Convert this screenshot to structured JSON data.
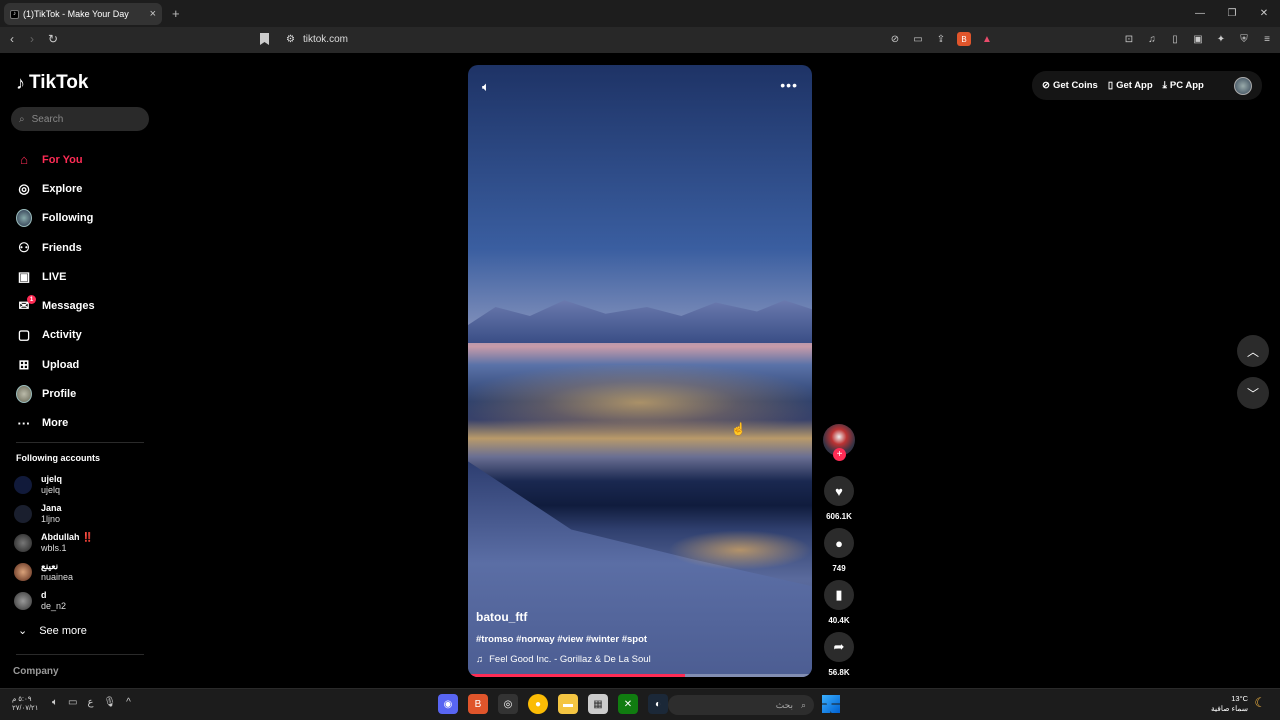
{
  "browser": {
    "tab_title": "(1)TikTok - Make Your Day",
    "url": "tiktok.com",
    "new_tab": "+",
    "close": "×"
  },
  "sidebar": {
    "logo": "TikTok",
    "search_placeholder": "Search",
    "items": [
      {
        "label": "For You",
        "icon": "home-icon"
      },
      {
        "label": "Explore",
        "icon": "compass-icon"
      },
      {
        "label": "Following",
        "icon": "avatar-icon"
      },
      {
        "label": "Friends",
        "icon": "friends-icon"
      },
      {
        "label": "LIVE",
        "icon": "live-icon"
      },
      {
        "label": "Messages",
        "icon": "messages-icon",
        "badge": "1"
      },
      {
        "label": "Activity",
        "icon": "activity-icon"
      },
      {
        "label": "Upload",
        "icon": "upload-icon"
      },
      {
        "label": "Profile",
        "icon": "profile-icon"
      },
      {
        "label": "More",
        "icon": "more-icon"
      }
    ],
    "following_title": "Following accounts",
    "accounts": [
      {
        "name": "ujelq",
        "username": "ujelq"
      },
      {
        "name": "Jana",
        "username": "1ljno"
      },
      {
        "name": "Abdullah ‼️",
        "username": "wbls.1"
      },
      {
        "name": "نعينع",
        "username": "nuainea"
      },
      {
        "name": "d",
        "username": "de_n2"
      }
    ],
    "see_more": "See more",
    "company": "Company"
  },
  "video": {
    "author": "batou_ftf",
    "description": "#tromso #norway #view #winter #spot",
    "music": "Feel Good Inc. - Gorillaz & De La Soul",
    "progress": 0.63
  },
  "actions": {
    "likes": "606.1K",
    "comments": "749",
    "saves": "40.4K",
    "shares": "56.8K"
  },
  "topbar": {
    "get_coins": "Get Coins",
    "get_app": "Get App",
    "pc_app": "PC App"
  },
  "taskbar": {
    "time": "٥:٠٩ م",
    "date": "٢٧/٠٧/٢١",
    "lang": "ع",
    "search_label": "بحث",
    "temperature": "13°C",
    "weather": "سماء صافية"
  }
}
